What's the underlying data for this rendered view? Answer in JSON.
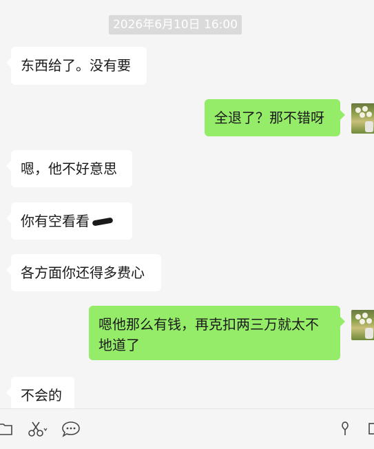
{
  "timestamp": "2026年6月10日 16:00",
  "messages": [
    {
      "side": "in",
      "text": "东西给了。没有要"
    },
    {
      "side": "out",
      "text": "全退了？那不错呀"
    },
    {
      "side": "in",
      "text": "嗯，他不好意思"
    },
    {
      "side": "in",
      "text": "你有空看看"
    },
    {
      "side": "in",
      "text": "各方面你还得多费心"
    },
    {
      "side": "out",
      "text_line1": "嗯他那么有钱，再克扣两三万就太不",
      "text_line2": "地道了"
    },
    {
      "side": "in",
      "text": "不会的"
    }
  ],
  "toolbar": {
    "icons": [
      "folder-icon",
      "scissors-icon",
      "chat-icon",
      "pin-icon",
      "window-icon"
    ]
  },
  "colors": {
    "background": "#f5f5f5",
    "incoming_bubble": "#ffffff",
    "outgoing_bubble": "#95ec69",
    "timestamp_bg": "#dadada"
  }
}
